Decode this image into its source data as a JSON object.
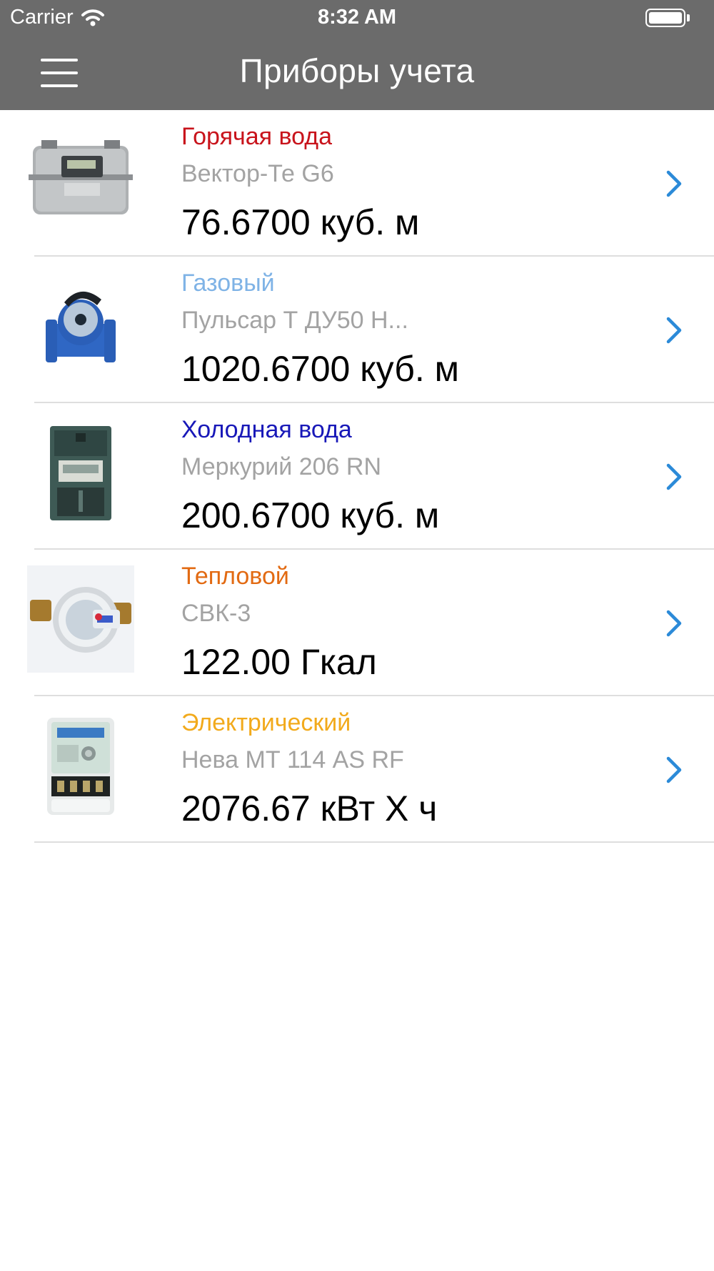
{
  "status_bar": {
    "carrier": "Carrier",
    "time": "8:32 AM"
  },
  "nav": {
    "title": "Приборы учета",
    "menu_icon": "hamburger-menu-icon"
  },
  "colors": {
    "bar_background": "#6b6b6b",
    "chevron": "#2b8ad8",
    "model_text": "#a3a3a3"
  },
  "meters": [
    {
      "type": "Горячая вода",
      "type_color": "#c8131b",
      "model": "Вектор-Те G6",
      "reading": "76.6700 куб. м",
      "icon": "gas-meter-icon"
    },
    {
      "type": "Газовый",
      "type_color": "#7fb3e6",
      "model": "Пульсар Т ДУ50 Н...",
      "reading": "1020.6700 куб. м",
      "icon": "water-meter-icon"
    },
    {
      "type": "Холодная вода",
      "type_color": "#1818b8",
      "model": "Меркурий 206 RN",
      "reading": "200.6700 куб. м",
      "icon": "electric-meter-dark-icon"
    },
    {
      "type": "Тепловой",
      "type_color": "#e26a12",
      "model": "СВК-3",
      "reading": "122.00 Гкал",
      "icon": "heat-meter-icon"
    },
    {
      "type": "Электрический",
      "type_color": "#f2aa1c",
      "model": "Нева МТ 114 AS RF",
      "reading": "2076.67 кВт Х ч",
      "icon": "electric-meter-white-icon"
    }
  ]
}
